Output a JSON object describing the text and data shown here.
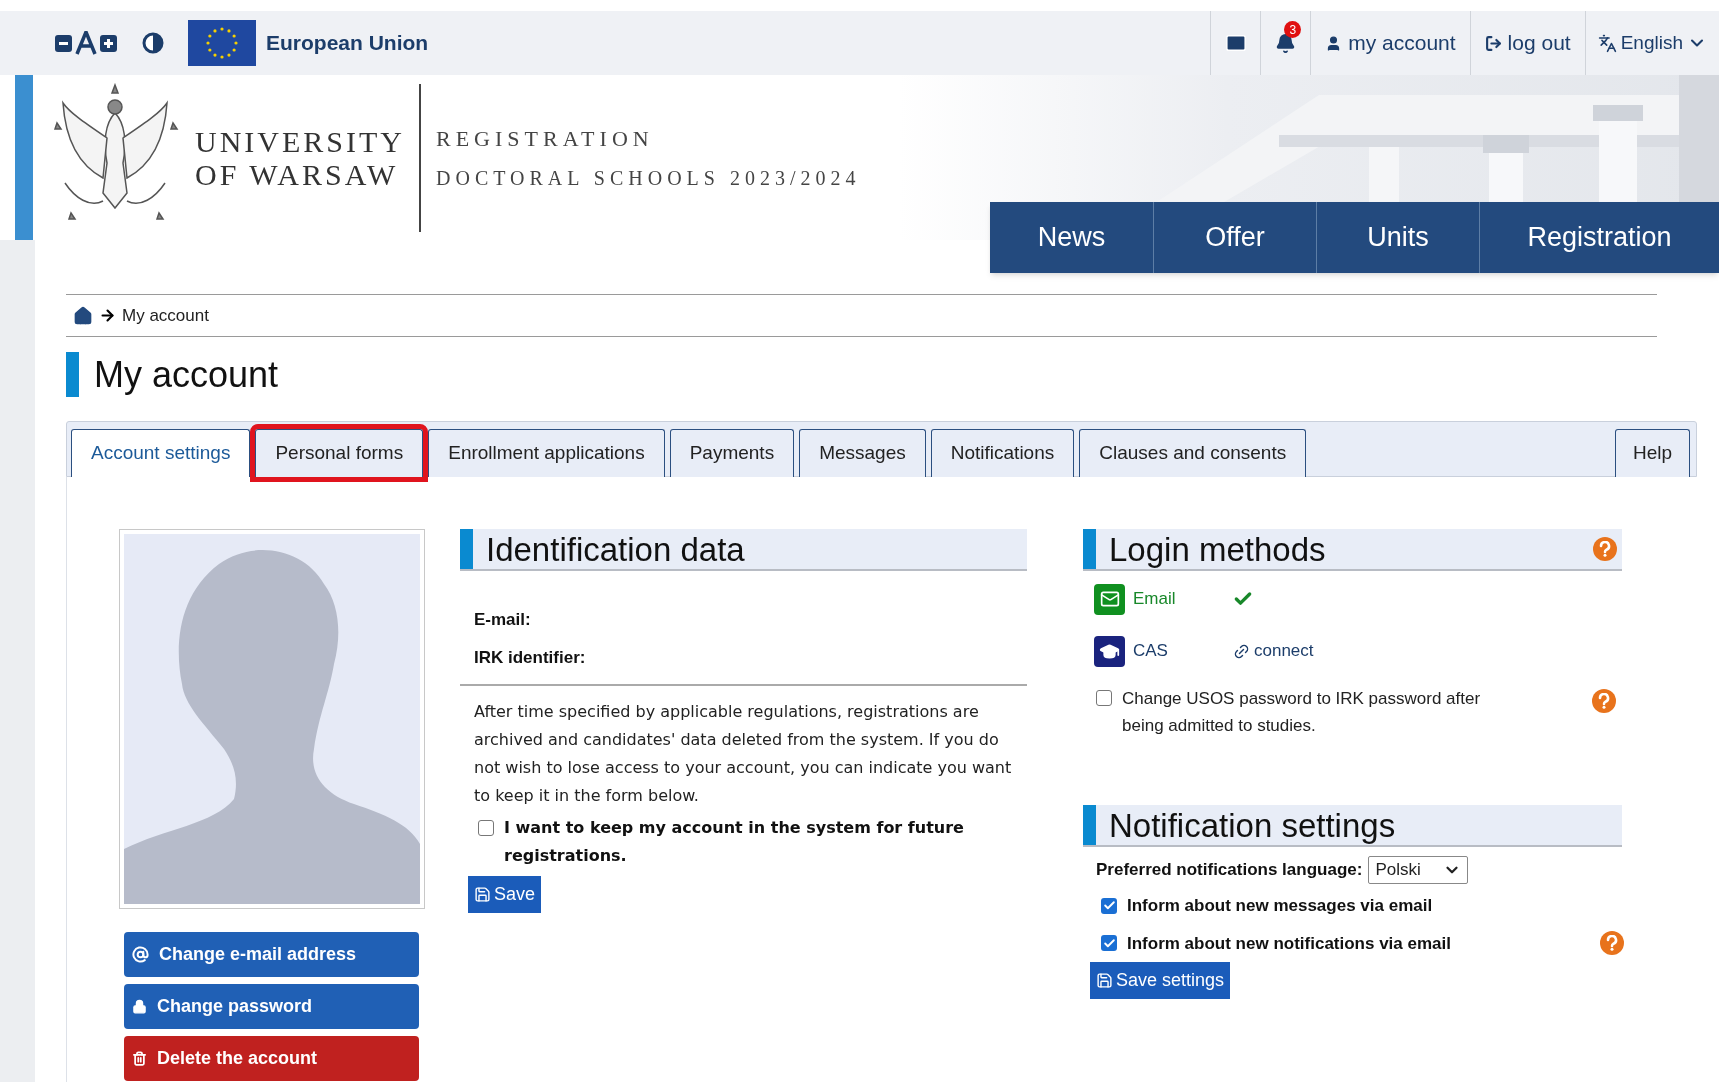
{
  "top_bar": {
    "eu_label": "European Union",
    "notification_count": "3",
    "links": [
      {
        "kind": "account",
        "label": "my account"
      },
      {
        "kind": "logout",
        "label": "log out"
      }
    ],
    "language": "English"
  },
  "header": {
    "university": [
      "UNIVERSITY",
      "OF WARSAW"
    ],
    "title": "REGISTRATION",
    "subtitle": "DOCTORAL SCHOOLS 2023/2024"
  },
  "nav": [
    "News",
    "Offer",
    "Units",
    "Registration"
  ],
  "breadcrumb": "My account",
  "page_title": "My account",
  "tabs": [
    {
      "label": "Account settings",
      "selected": true,
      "highlighted": false
    },
    {
      "label": "Personal forms",
      "selected": false,
      "highlighted": true
    },
    {
      "label": "Enrollment applications",
      "selected": false,
      "highlighted": false
    },
    {
      "label": "Payments",
      "selected": false,
      "highlighted": false
    },
    {
      "label": "Messages",
      "selected": false,
      "highlighted": false
    },
    {
      "label": "Notifications",
      "selected": false,
      "highlighted": false
    },
    {
      "label": "Clauses and consents",
      "selected": false,
      "highlighted": false
    }
  ],
  "help_tab": "Help",
  "account_buttons": [
    {
      "kind": "email",
      "label": "Change e-mail address"
    },
    {
      "kind": "password",
      "label": "Change password"
    },
    {
      "kind": "delete",
      "label": "Delete the account"
    }
  ],
  "identification": {
    "title": "Identification data",
    "fields": [
      "E-mail:",
      "IRK identifier:"
    ],
    "notice": "After time specified by applicable regulations, registrations are archived and candidates' data deleted from the system. If you do not wish to lose access to your account, you can indicate you want to keep it in the form below.",
    "keep_account": {
      "label": "I want to keep my account in the system for future registrations.",
      "checked": false
    },
    "save": "Save"
  },
  "login_methods": {
    "title": "Login methods",
    "methods": [
      {
        "kind": "email",
        "name": "Email",
        "connected": true
      },
      {
        "kind": "cas",
        "name": "CAS",
        "connected": false,
        "action": "connect"
      }
    ],
    "usos_password": {
      "label": "Change USOS password to IRK password after being admitted to studies.",
      "checked": false
    }
  },
  "notification_settings": {
    "title": "Notification settings",
    "language_label": "Preferred notifications language:",
    "language_value": "Polski",
    "options": [
      {
        "label": "Inform about new messages via email",
        "checked": true
      },
      {
        "label": "Inform about new notifications via email",
        "checked": true
      }
    ],
    "save": "Save settings"
  }
}
